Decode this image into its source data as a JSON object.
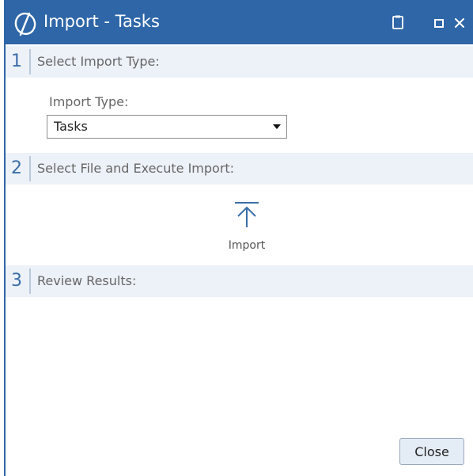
{
  "window": {
    "title": "Import - Tasks",
    "titlebar_color": "#2e66a8",
    "icons": [
      "app-logo-icon",
      "clipboard-icon",
      "maximize-icon",
      "close-icon"
    ]
  },
  "steps": [
    {
      "number": "1",
      "title": "Select Import Type:"
    },
    {
      "number": "2",
      "title": "Select File and Execute Import:"
    },
    {
      "number": "3",
      "title": "Review Results:"
    }
  ],
  "import_type": {
    "label": "Import Type:",
    "selected": "Tasks"
  },
  "import_action": {
    "label": "Import",
    "icon": "upload-arrow-icon"
  },
  "footer": {
    "close_label": "Close"
  },
  "colors": {
    "accent": "#2e66a8",
    "step_band": "#edf2f8",
    "step_number": "#3a6ea8"
  }
}
